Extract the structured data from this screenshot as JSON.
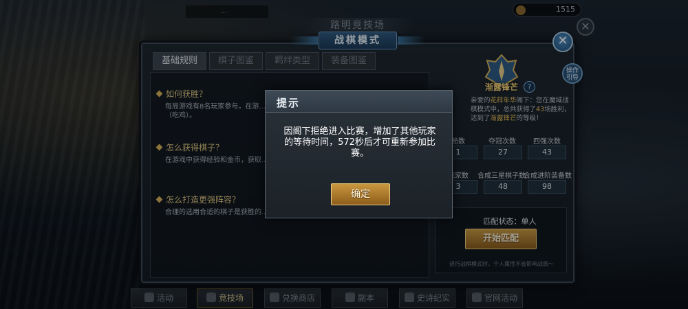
{
  "top_bar": {
    "currency_value": "1515",
    "ribbon_text": "...",
    "banner_text": "路明竞技场"
  },
  "window": {
    "title": "战棋模式",
    "close_icon": "close-icon"
  },
  "tabs": [
    {
      "label": "基础规则",
      "active": true
    },
    {
      "label": "棋子图鉴",
      "active": false
    },
    {
      "label": "羁绊类型",
      "active": false
    },
    {
      "label": "装备图鉴",
      "active": false
    }
  ],
  "rules": [
    {
      "title": "如何获胜？",
      "text": "每局游戏有8名玩家参与，在游...失败的玩家会损失生命值，生命...玩家获得最终胜利（吃鸡）。"
    },
    {
      "title": "怎么获得棋子？",
      "text": "在游戏中获得经验和金币，获取...数量，高品质棋子的抽取率也会...棋子。"
    },
    {
      "title": "怎么打造更强阵容？",
      "text": "合理的选用合适的棋子是获胜的...棋子更加强大！上阵特定种族...效果加成。"
    }
  ],
  "rank": {
    "name": "渐露锋芒",
    "help_icon": "?",
    "guide_label": "操作引导"
  },
  "intro": {
    "prefix": "亲爱的",
    "player": "花样年华",
    "mid1": "阁下：您在魔域战棋模式中，总共获得了",
    "wins": "43",
    "mid2": "场胜利，达到了",
    "rank": "渐露锋芒",
    "suffix": "的等级！"
  },
  "stats": [
    {
      "label": "局数",
      "value": "1"
    },
    {
      "label": "夺冠次数",
      "value": "27"
    },
    {
      "label": "四强次数",
      "value": "43"
    },
    {
      "label": "玩家数",
      "value": "3"
    },
    {
      "label": "合成三星棋子数",
      "value": "48"
    },
    {
      "label": "合成进阶装备数",
      "value": "98"
    }
  ],
  "match": {
    "status": "匹配状态：单人",
    "start_label": "开始匹配",
    "note": "进行战棋模式时，个人属性不会影响战局～"
  },
  "bottom_nav": [
    {
      "label": "活动",
      "active": false
    },
    {
      "label": "竞技场",
      "active": true
    },
    {
      "label": "兑换商店",
      "active": false
    },
    {
      "label": "副本",
      "active": false
    },
    {
      "label": "史诗纪实",
      "active": false
    },
    {
      "label": "官网活动",
      "active": false
    }
  ],
  "dialog": {
    "title": "提示",
    "message": "因阁下拒绝进入比赛，增加了其他玩家的等待时间，572秒后才可重新参加比赛。",
    "confirm_label": "确定"
  }
}
